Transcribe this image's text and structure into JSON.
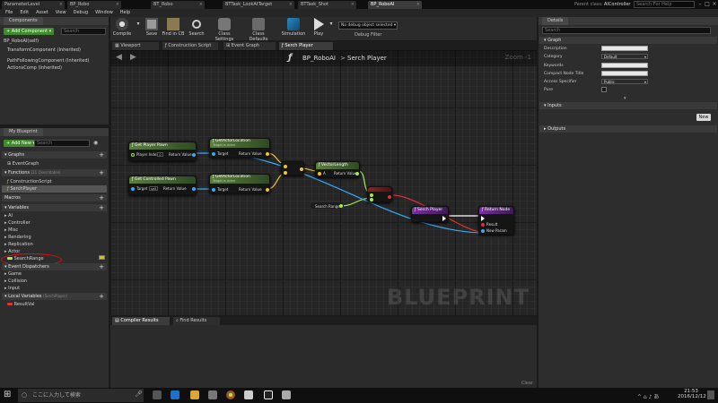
{
  "window": {
    "doc_tabs": [
      "ParameterLevel",
      "BP_Robo",
      "BT_Robo",
      "BTTask_LookAtTarget",
      "BTTask_Shot",
      "BP_RoboAI"
    ],
    "active_tab_index": 5,
    "parent_class_label": "Parent class:",
    "parent_class_value": "AIController",
    "help_search_placeholder": "Search For Help"
  },
  "menu": [
    "File",
    "Edit",
    "Asset",
    "View",
    "Debug",
    "Window",
    "Help"
  ],
  "components_panel": {
    "title": "Components",
    "add_button": "+ Add Component ▾",
    "search_placeholder": "Search",
    "items": [
      "BP_RoboAI(self)",
      "TransformComponent (Inherited)",
      "PathFollowingComponent (Inherited)",
      "ActionsComp (Inherited)"
    ]
  },
  "my_blueprint": {
    "title": "My Blueprint",
    "add_new": "+ Add New ▾",
    "search_placeholder": "Search",
    "sections": {
      "graphs": "Graphs",
      "event_graph": "EventGraph",
      "functions": "Functions",
      "functions_note": "(21 Overridable)",
      "construction_script": "ConstructionScript",
      "serch_player": "SerchPlayer",
      "macros": "Macros",
      "variables": "Variables",
      "var_categories": [
        "AI",
        "Controller",
        "Misc",
        "Rendering",
        "Replication",
        "Actor"
      ],
      "search_range": "SearchRange",
      "event_dispatchers": "Event Dispatchers",
      "dispatcher_categories": [
        "Game",
        "Collision",
        "Input"
      ],
      "local_variables": "Local Variables",
      "local_variables_note": "(SerchPlayer)",
      "result_val": "ResultVal"
    }
  },
  "toolbar": {
    "buttons": [
      "Compile",
      "Save",
      "Find in CB",
      "Search",
      "Class Settings",
      "Class Defaults",
      "Simulation",
      "Play"
    ],
    "debug_select": "No debug object selected ▾",
    "debug_filter": "Debug Filter"
  },
  "graph_tabs": [
    "Viewport",
    "Construction Script",
    "Event Graph",
    "Serch Player"
  ],
  "graph": {
    "breadcrumb_class": "BP_RoboAI",
    "breadcrumb_sep": ">",
    "breadcrumb_func": "Serch Player",
    "zoom": "Zoom -1",
    "watermark": "BLUEPRINT",
    "nodes": {
      "get_player_pawn": {
        "title": "Get Player Pawn",
        "pin_in": "Player Index",
        "pin_in_val": "0",
        "pin_out": "Return Value"
      },
      "get_actor_location_1": {
        "title": "GetActorLocation",
        "subtitle": "Target is Actor",
        "pin_in": "Target",
        "pin_out": "Return Value"
      },
      "get_controlled_pawn": {
        "title": "Get Controlled Pawn",
        "pin_in": "Target",
        "pin_in_val": "self",
        "pin_out": "Return Value"
      },
      "get_actor_location_2": {
        "title": "GetActorLocation",
        "subtitle": "Target is Actor",
        "pin_in": "Target",
        "pin_out": "Return Value"
      },
      "vector_length": {
        "title": "VectorLength",
        "pin_in": "A",
        "pin_out": "Return Value"
      },
      "search_range": {
        "label": "Search Range"
      },
      "serch_player_entry": {
        "title": "Serch Player"
      },
      "return_node": {
        "title": "Return Node",
        "pin_result": "Result",
        "pin_new_param": "New Param"
      }
    }
  },
  "bottom_panel": {
    "tabs": [
      "Compiler Results",
      "Find Results"
    ],
    "clear": "Clear"
  },
  "details": {
    "title": "Details",
    "search_placeholder": "Search",
    "graph_section": "Graph",
    "rows": [
      {
        "label": "Description",
        "value": ""
      },
      {
        "label": "Category",
        "value": "Default"
      },
      {
        "label": "Keywords",
        "value": ""
      },
      {
        "label": "Compact Node Title",
        "value": ""
      },
      {
        "label": "Access Specifier",
        "value": "Public"
      },
      {
        "label": "Pure",
        "value": ""
      }
    ],
    "inputs_section": "Inputs",
    "new_button": "New",
    "outputs_section": "Outputs"
  },
  "taskbar": {
    "search_text": "ここに入力して検索",
    "time": "21:53",
    "date": "2016/12/12"
  },
  "colors": {
    "accent_green": "#3f8a2a",
    "node_green": "#5c7f3c",
    "node_purple": "#7d2fa8",
    "wire_blue": "#33aaff",
    "wire_yellow": "#f4c430",
    "wire_green": "#a5e85a",
    "annotation_red": "#e01010"
  }
}
